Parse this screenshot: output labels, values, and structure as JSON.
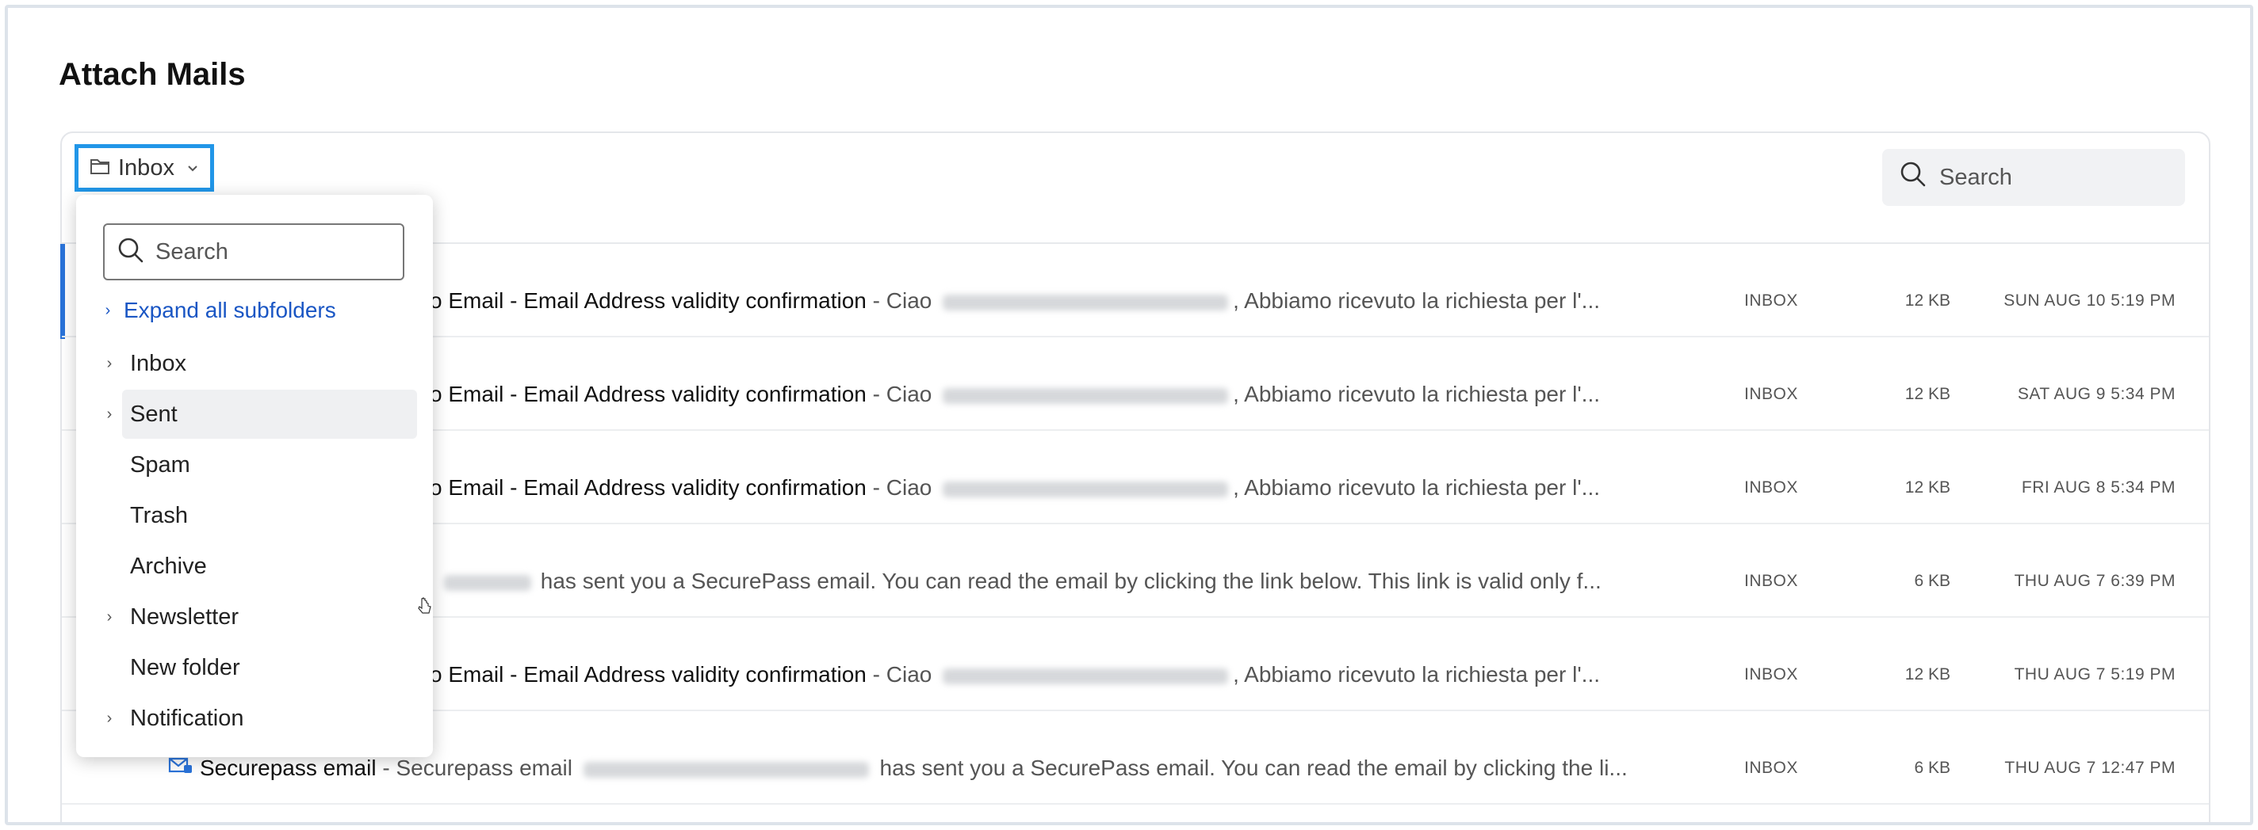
{
  "page": {
    "title": "Attach Mails"
  },
  "toolbar": {
    "folder_selector_label": "Inbox",
    "search_placeholder": "Search"
  },
  "dropdown": {
    "search_placeholder": "Search",
    "expand_all_label": "Expand all subfolders",
    "folders": [
      {
        "label": "Inbox",
        "has_children": true
      },
      {
        "label": "Sent",
        "has_children": true,
        "hovered": true
      },
      {
        "label": "Spam",
        "has_children": false
      },
      {
        "label": "Trash",
        "has_children": false
      },
      {
        "label": "Archive",
        "has_children": false
      },
      {
        "label": "Newsletter",
        "has_children": true
      },
      {
        "label": "New folder",
        "has_children": false
      },
      {
        "label": "Notification",
        "has_children": true
      }
    ]
  },
  "mails": [
    {
      "subject": "o Email - Email Address validity confirmation",
      "preview_before": " - Ciao ",
      "preview_after": ", Abbiamo ricevuto la richiesta per l'...",
      "folder": "INBOX",
      "size": "12 KB",
      "date": "SUN AUG 10 5:19 PM"
    },
    {
      "subject": "o Email - Email Address validity confirmation",
      "preview_before": " - Ciao ",
      "preview_after": ", Abbiamo ricevuto la richiesta per l'...",
      "folder": "INBOX",
      "size": "12 KB",
      "date": "SAT AUG 9 5:34 PM"
    },
    {
      "subject": "o Email - Email Address validity confirmation",
      "preview_before": " - Ciao ",
      "preview_after": ", Abbiamo ricevuto la richiesta per l'...",
      "folder": "INBOX",
      "size": "12 KB",
      "date": "FRI AUG 8 5:34 PM"
    },
    {
      "subject": "",
      "preview_before": "",
      "preview_after": " has sent you a SecurePass email. You can read the email by clicking the link below. This link is valid only f...",
      "folder": "INBOX",
      "size": "6 KB",
      "date": "THU AUG 7 6:39 PM"
    },
    {
      "subject": "o Email - Email Address validity confirmation",
      "preview_before": " - Ciao ",
      "preview_after": ", Abbiamo ricevuto la richiesta per l'...",
      "folder": "INBOX",
      "size": "12 KB",
      "date": "THU AUG 7 5:19 PM"
    },
    {
      "subject": "Securepass email",
      "preview_before": " - Securepass email ",
      "preview_after": " has sent you a SecurePass email. You can read the email by clicking the li...",
      "folder": "INBOX",
      "size": "6 KB",
      "date": "THU AUG 7 12:47 PM"
    }
  ],
  "colors": {
    "accent_blue": "#2196e8",
    "link_blue": "#1a56c4",
    "selection_bar": "#2a73d9"
  }
}
